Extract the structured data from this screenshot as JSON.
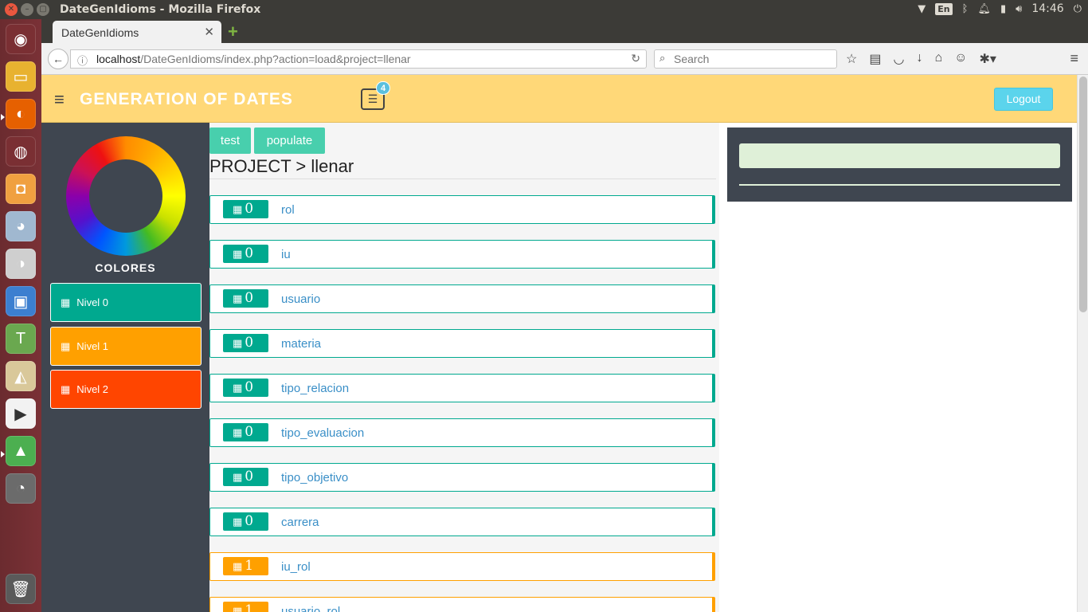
{
  "os": {
    "window_title": "DateGenIdioms - Mozilla Firefox",
    "lang": "En",
    "clock": "14:46"
  },
  "browser": {
    "tab_title": "DateGenIdioms",
    "url_host": "localhost",
    "url_path": "/DateGenIdioms/index.php?action=load&project=llenar",
    "search_placeholder": "Search"
  },
  "header": {
    "brand": "GENERATION OF DATES",
    "notification_count": "4",
    "logout_label": "Logout",
    "color": "#ffd878"
  },
  "sidebar": {
    "colors_title": "COLORES",
    "levels": [
      {
        "label": "Nivel 0",
        "color": "#00a98f"
      },
      {
        "label": "Nivel 1",
        "color": "#ffa000"
      },
      {
        "label": "Nivel 2",
        "color": "#ff4500"
      }
    ]
  },
  "main": {
    "actions": [
      "test",
      "populate"
    ],
    "title": "PROJECT > llenar",
    "entities": [
      {
        "count": "0",
        "name": "rol"
      },
      {
        "count": "0",
        "name": "iu"
      },
      {
        "count": "0",
        "name": "usuario"
      },
      {
        "count": "0",
        "name": "materia"
      },
      {
        "count": "0",
        "name": "tipo_relacion"
      },
      {
        "count": "0",
        "name": "tipo_evaluacion"
      },
      {
        "count": "0",
        "name": "tipo_objetivo"
      },
      {
        "count": "0",
        "name": "carrera"
      },
      {
        "count": "1",
        "name": "iu_rol"
      },
      {
        "count": "1",
        "name": "usuario_rol"
      }
    ]
  }
}
